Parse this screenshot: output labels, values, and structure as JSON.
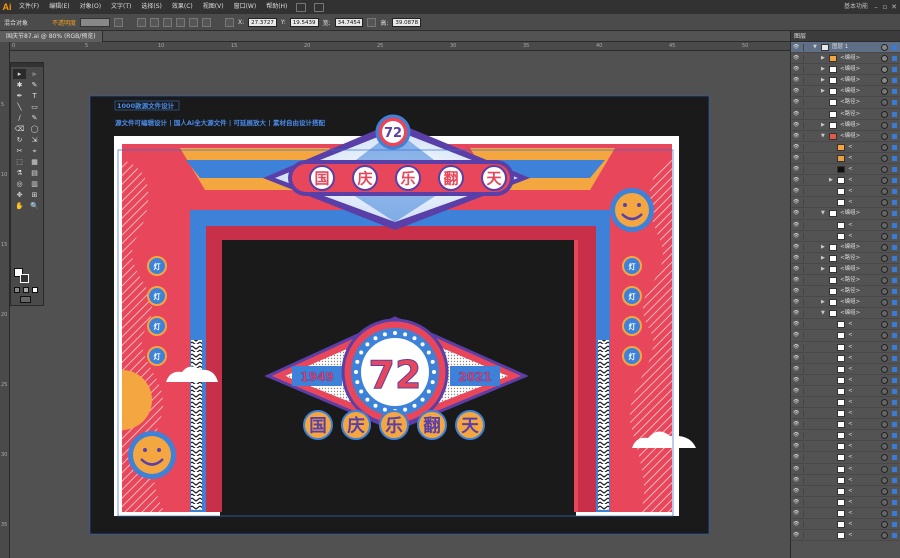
{
  "app": {
    "logo": "Ai",
    "workspace": "基本功能"
  },
  "menu": [
    "文件(F)",
    "编辑(E)",
    "对象(O)",
    "文字(T)",
    "选择(S)",
    "效果(C)",
    "视图(V)",
    "窗口(W)",
    "帮助(H)"
  ],
  "control": {
    "selection": "混合对象",
    "opacity_label": "不透明度",
    "x_label": "X:",
    "x": "27.3727",
    "y_label": "Y:",
    "y": "19.5439",
    "w_label": "宽:",
    "w": "34.7454",
    "h_label": "高:",
    "h": "39.0878"
  },
  "document": {
    "tab": "国庆节87.ai @ 80% (RGB/预览)"
  },
  "ruler": {
    "h": [
      "0",
      "5",
      "10",
      "15",
      "20",
      "25",
      "30",
      "35",
      "40",
      "45",
      "50"
    ],
    "v": [
      "5",
      "10",
      "15",
      "20",
      "25",
      "30",
      "35"
    ]
  },
  "tools": [
    "▸",
    "▹",
    "✱",
    "✎",
    "✒",
    "T",
    "╲",
    "▭",
    "∕",
    "✎",
    "⌫",
    "◯",
    "↻",
    "⇲",
    "✂",
    "⌖",
    "⬚",
    "▦",
    "⚗",
    "▤",
    "◎",
    "▥",
    "✥",
    "⊞",
    "✋",
    "🔍"
  ],
  "layers": {
    "title": "图层",
    "rows": [
      {
        "name": "图层 1",
        "kind": "layer",
        "depth": 0,
        "exp": "down",
        "thumb": "#e7e7e7",
        "tgt": "#888"
      },
      {
        "name": "<编组>",
        "depth": 1,
        "exp": "right",
        "thumb": "#f4a340",
        "tgt": "#888"
      },
      {
        "name": "<编组>",
        "depth": 1,
        "exp": "right",
        "thumb": "#ffffff",
        "tgt": "#888"
      },
      {
        "name": "<编组>",
        "depth": 1,
        "exp": "right",
        "thumb": "#ffffff",
        "tgt": "#888"
      },
      {
        "name": "<编组>",
        "depth": 1,
        "exp": "right",
        "thumb": "#ffffff",
        "tgt": "#777"
      },
      {
        "name": "<路径>",
        "depth": 1,
        "exp": "",
        "thumb": "#ffffff",
        "tgt": "#666"
      },
      {
        "name": "<路径>",
        "depth": 1,
        "exp": "",
        "thumb": "#ffffff",
        "tgt": "#666"
      },
      {
        "name": "<编组>",
        "depth": 1,
        "exp": "right",
        "thumb": "#ffffff",
        "tgt": "#666"
      },
      {
        "name": "<编组>",
        "depth": 1,
        "exp": "down",
        "thumb": "#e05a48",
        "tgt": "#666"
      },
      {
        "name": "<",
        "depth": 2,
        "exp": "",
        "thumb": "#f4a340",
        "tgt": "#666"
      },
      {
        "name": "<",
        "depth": 2,
        "exp": "",
        "thumb": "#e8a040",
        "tgt": "#666"
      },
      {
        "name": "<",
        "depth": 2,
        "exp": "",
        "thumb": "#111111",
        "tgt": "#666"
      },
      {
        "name": "<",
        "depth": 2,
        "exp": "right",
        "thumb": "#ffffff",
        "tgt": "#666"
      },
      {
        "name": "<",
        "depth": 2,
        "exp": "",
        "thumb": "#ffffff",
        "tgt": "#666"
      },
      {
        "name": "<",
        "depth": 2,
        "exp": "",
        "thumb": "#ffffff",
        "tgt": "#666"
      },
      {
        "name": "<编组>",
        "depth": 1,
        "exp": "down",
        "thumb": "#ffffff",
        "tgt": "#666"
      },
      {
        "name": "<",
        "depth": 2,
        "exp": "",
        "thumb": "#ffffff",
        "tgt": "#666"
      },
      {
        "name": "<",
        "depth": 2,
        "exp": "",
        "thumb": "#ffffff",
        "tgt": "#666"
      },
      {
        "name": "<编组>",
        "depth": 1,
        "exp": "right",
        "thumb": "#ffffff",
        "tgt": "#666"
      },
      {
        "name": "<路径>",
        "depth": 1,
        "exp": "right",
        "thumb": "#ffffff",
        "tgt": "#666"
      },
      {
        "name": "<编组>",
        "depth": 1,
        "exp": "right",
        "thumb": "#ffffff",
        "tgt": "#666"
      },
      {
        "name": "<路径>",
        "depth": 1,
        "exp": "",
        "thumb": "#ffffff",
        "tgt": "#666"
      },
      {
        "name": "<路径>",
        "depth": 1,
        "exp": "",
        "thumb": "#ffffff",
        "tgt": "#666"
      },
      {
        "name": "<编组>",
        "depth": 1,
        "exp": "right",
        "thumb": "#ffffff",
        "tgt": "#666"
      },
      {
        "name": "<编组>",
        "depth": 1,
        "exp": "down",
        "thumb": "#ffffff",
        "tgt": "#666"
      },
      {
        "name": "<",
        "depth": 2,
        "exp": "",
        "thumb": "#ffffff",
        "tgt": "#666"
      },
      {
        "name": "<",
        "depth": 2,
        "exp": "",
        "thumb": "#ffffff",
        "tgt": "#666"
      },
      {
        "name": "<",
        "depth": 2,
        "exp": "",
        "thumb": "#ffffff",
        "tgt": "#666"
      },
      {
        "name": "<",
        "depth": 2,
        "exp": "",
        "thumb": "#ffffff",
        "tgt": "#666"
      },
      {
        "name": "<",
        "depth": 2,
        "exp": "",
        "thumb": "#ffffff",
        "tgt": "#666"
      },
      {
        "name": "<",
        "depth": 2,
        "exp": "",
        "thumb": "#ffffff",
        "tgt": "#666"
      },
      {
        "name": "<",
        "depth": 2,
        "exp": "",
        "thumb": "#ffffff",
        "tgt": "#666"
      },
      {
        "name": "<",
        "depth": 2,
        "exp": "",
        "thumb": "#ffffff",
        "tgt": "#666"
      },
      {
        "name": "<",
        "depth": 2,
        "exp": "",
        "thumb": "#ffffff",
        "tgt": "#666"
      },
      {
        "name": "<",
        "depth": 2,
        "exp": "",
        "thumb": "#ffffff",
        "tgt": "#666"
      },
      {
        "name": "<",
        "depth": 2,
        "exp": "",
        "thumb": "#ffffff",
        "tgt": "#666"
      },
      {
        "name": "<",
        "depth": 2,
        "exp": "",
        "thumb": "#ffffff",
        "tgt": "#666"
      },
      {
        "name": "<",
        "depth": 2,
        "exp": "",
        "thumb": "#ffffff",
        "tgt": "#666"
      },
      {
        "name": "<",
        "depth": 2,
        "exp": "",
        "thumb": "#ffffff",
        "tgt": "#666"
      },
      {
        "name": "<",
        "depth": 2,
        "exp": "",
        "thumb": "#ffffff",
        "tgt": "#666"
      },
      {
        "name": "<",
        "depth": 2,
        "exp": "",
        "thumb": "#ffffff",
        "tgt": "#666"
      },
      {
        "name": "<",
        "depth": 2,
        "exp": "",
        "thumb": "#ffffff",
        "tgt": "#666"
      },
      {
        "name": "<",
        "depth": 2,
        "exp": "",
        "thumb": "#ffffff",
        "tgt": "#666"
      },
      {
        "name": "<",
        "depth": 2,
        "exp": "",
        "thumb": "#ffffff",
        "tgt": "#666"
      },
      {
        "name": "<",
        "depth": 2,
        "exp": "",
        "thumb": "#ffffff",
        "tgt": "#666"
      }
    ]
  },
  "artwork": {
    "note_line1": "1000款源文件设计",
    "note_line2": "源文件可编辑设计 | 国人Ai全大源文件 | 可延展放大 | 素材自由设计搭配",
    "badge_small": "72",
    "banner_top": [
      "国",
      "庆",
      "乐",
      "翻",
      "天"
    ],
    "badge_big": "72",
    "year_left": "1949",
    "year_right": "2021",
    "banner_bottom": [
      "国",
      "庆",
      "乐",
      "翻",
      "天"
    ],
    "pillar_icons": [
      "灯",
      "灯",
      "灯",
      "灯"
    ],
    "colors": {
      "red": "#e8465a",
      "blue": "#3d82d8",
      "orange": "#f4a640",
      "navy": "#5a3fa8",
      "black": "#1a1a1a",
      "white": "#ffffff",
      "cream": "#f3e8dc"
    }
  }
}
